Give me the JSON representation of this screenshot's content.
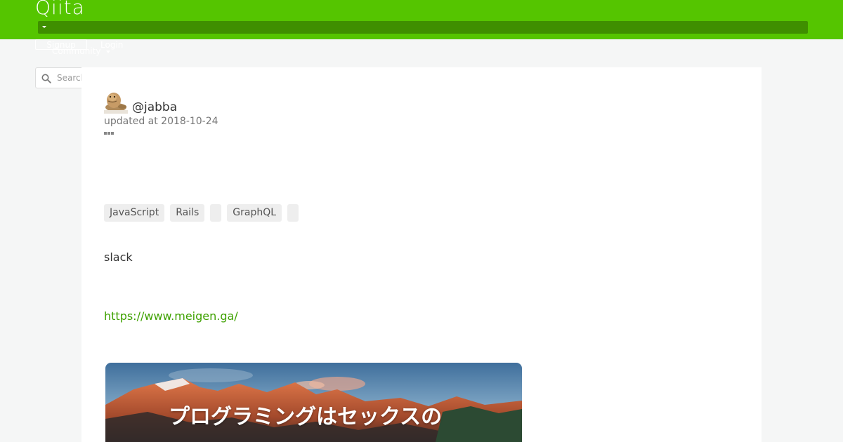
{
  "header": {
    "logo": "Qiita",
    "signup_label": "Signup",
    "login_label": "Login",
    "community_label": "Community",
    "search": {
      "placeholder": "Search",
      "value": ""
    }
  },
  "article": {
    "author": "@jabba",
    "updated": "updated at 2018-10-24",
    "tags": [
      {
        "label": "JavaScript"
      },
      {
        "label": "Rails"
      },
      {
        "label": ""
      },
      {
        "label": "GraphQL"
      },
      {
        "label": ""
      }
    ],
    "body_text": "slack",
    "link_text": "https://www.meigen.ga/",
    "ogp_title": "プログラミングはセックスの"
  },
  "icons": {
    "search": "search-icon",
    "more": "more-icon",
    "caret": "chevron-down-icon"
  },
  "colors": {
    "brand": "#55c500",
    "brand_dark": "#3f8f00",
    "link": "#3ea100",
    "background": "#f5f6f6"
  }
}
